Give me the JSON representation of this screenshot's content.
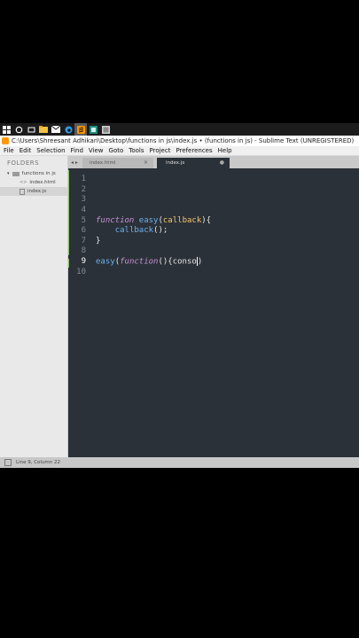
{
  "taskbar": {
    "icons": [
      "windows-start-icon",
      "search-icon",
      "file-explorer-icon",
      "mail-icon",
      "edge-browser-icon",
      "sublime-text-icon",
      "app-icon",
      "app-icon-2"
    ]
  },
  "window": {
    "title": "C:\\Users\\Shreesant Adhikari\\Desktop\\functions in js\\index.js • (functions in js) - Sublime Text (UNREGISTERED)"
  },
  "menu": {
    "items": [
      "File",
      "Edit",
      "Selection",
      "Find",
      "View",
      "Goto",
      "Tools",
      "Project",
      "Preferences",
      "Help"
    ]
  },
  "sidebar": {
    "heading": "FOLDERS",
    "folder": "functions in js",
    "files": [
      "index.html",
      "index.js"
    ]
  },
  "tabs": [
    {
      "label": "index.html",
      "close": "×"
    },
    {
      "label": "index.js",
      "close": "●"
    }
  ],
  "tab_nav": "◂ ▸",
  "editor": {
    "line_numbers": [
      "1",
      "2",
      "3",
      "4",
      "5",
      "6",
      "7",
      "8",
      "9",
      "10"
    ],
    "current_line": 9,
    "code": {
      "l5_kw": "function",
      "l5_fn": "easy",
      "l5_p1": "(",
      "l5_arg": "callback",
      "l5_p2": "){",
      "l6_fn": "callback",
      "l6_p": "();",
      "l7": "}",
      "l9_fn": "easy",
      "l9_p1": "(",
      "l9_kw": "function",
      "l9_p2": "(){conso",
      "l9_p3": ")"
    }
  },
  "status": {
    "text": "Line 9, Column 22"
  }
}
